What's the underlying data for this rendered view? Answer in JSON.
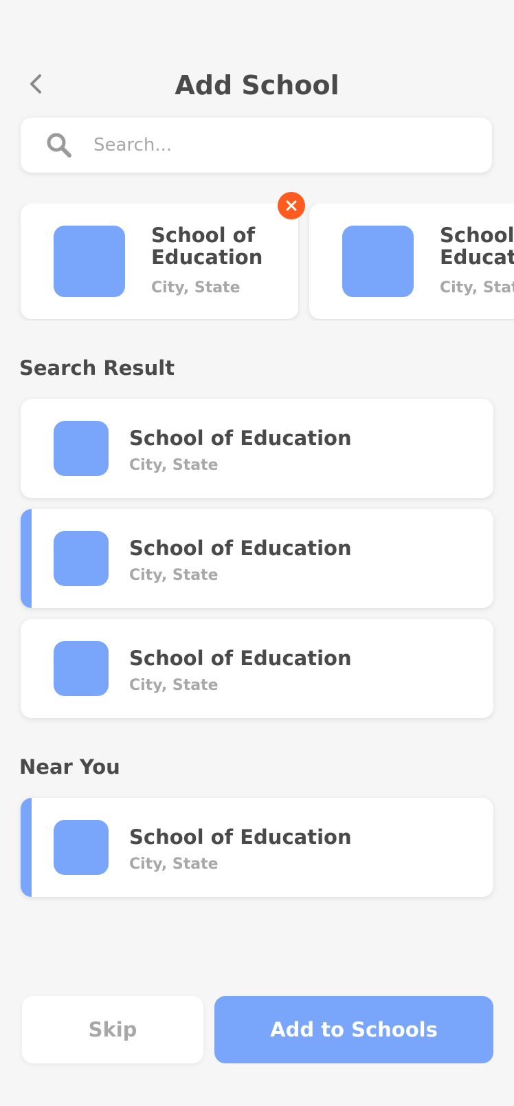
{
  "header": {
    "title": "Add School",
    "back_icon": "chevron-left-icon"
  },
  "search": {
    "placeholder": "Search...",
    "value": "",
    "icon": "search-icon"
  },
  "selected": [
    {
      "name": "School of Education",
      "location": "City, State"
    },
    {
      "name": "School of Education",
      "location": "City, State"
    }
  ],
  "search_results": {
    "title": "Search Result",
    "items": [
      {
        "name": "School of Education",
        "location": "City, State",
        "active": false
      },
      {
        "name": "School of Education",
        "location": "City, State",
        "active": true
      },
      {
        "name": "School of Education",
        "location": "City, State",
        "active": false
      }
    ]
  },
  "near_you": {
    "title": "Near You",
    "items": [
      {
        "name": "School of Education",
        "location": "City, State",
        "active": true
      }
    ]
  },
  "actions": {
    "skip_label": "Skip",
    "add_label": "Add to Schools"
  },
  "colors": {
    "accent": "#79a6fa",
    "remove": "#ff5a1f",
    "background": "#f6f6f6",
    "text": "#4a4a4a",
    "muted": "#a8a8a8"
  }
}
